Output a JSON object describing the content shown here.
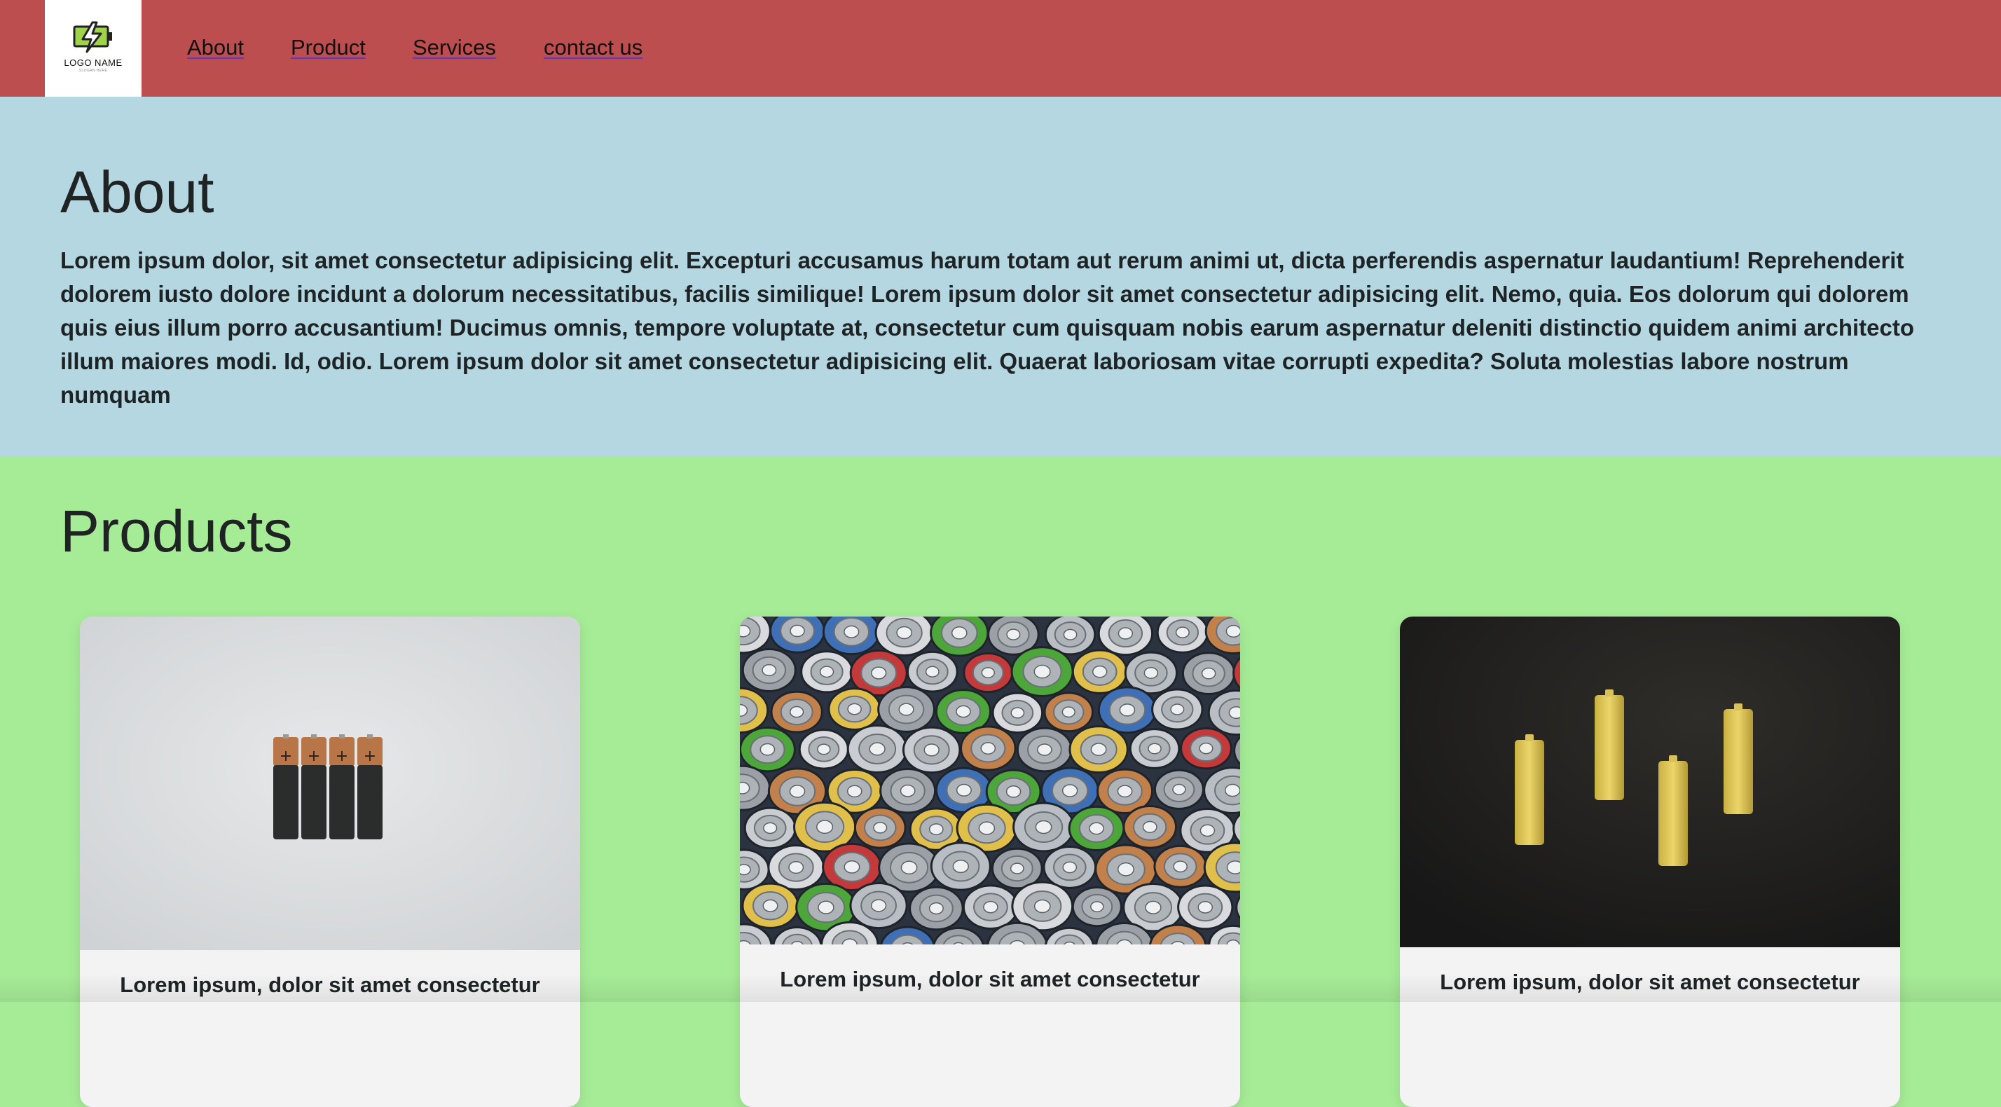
{
  "header": {
    "logo_name": "LOGO NAME",
    "logo_slogan": "SLOGAN HERE",
    "nav": [
      {
        "label": "About"
      },
      {
        "label": "Product"
      },
      {
        "label": "Services"
      },
      {
        "label": "contact us"
      }
    ]
  },
  "about": {
    "title": "About",
    "body": "Lorem ipsum dolor, sit amet consectetur adipisicing elit. Excepturi accusamus harum totam aut rerum animi ut, dicta perferendis aspernatur laudantium! Reprehenderit dolorem iusto dolore incidunt a dolorum necessitatibus, facilis similique! Lorem ipsum dolor sit amet consectetur adipisicing elit. Nemo, quia. Eos dolorum qui dolorem quis eius illum porro accusantium! Ducimus omnis, tempore voluptate at, consectetur cum quisquam nobis earum aspernatur deleniti distinctio quidem animi architecto illum maiores modi. Id, odio. Lorem ipsum dolor sit amet consectetur adipisicing elit. Quaerat laboriosam vitae corrupti expedita? Soluta molestias labore nostrum numquam"
  },
  "products": {
    "title": "Products",
    "cards": [
      {
        "caption": "Lorem ipsum, dolor sit amet consectetur",
        "image": "duracell-batteries-photo"
      },
      {
        "caption": "Lorem ipsum, dolor sit amet consectetur",
        "image": "battery-pile-photo"
      },
      {
        "caption": "Lorem ipsum, dolor sit amet consectetur",
        "image": "yellow-batteries-dark-photo"
      }
    ]
  },
  "colors": {
    "navbar": "#bd4e4f",
    "about_bg": "#b4d7e2",
    "products_bg": "#a6ec97",
    "link_underline": "#5a3bc9"
  }
}
